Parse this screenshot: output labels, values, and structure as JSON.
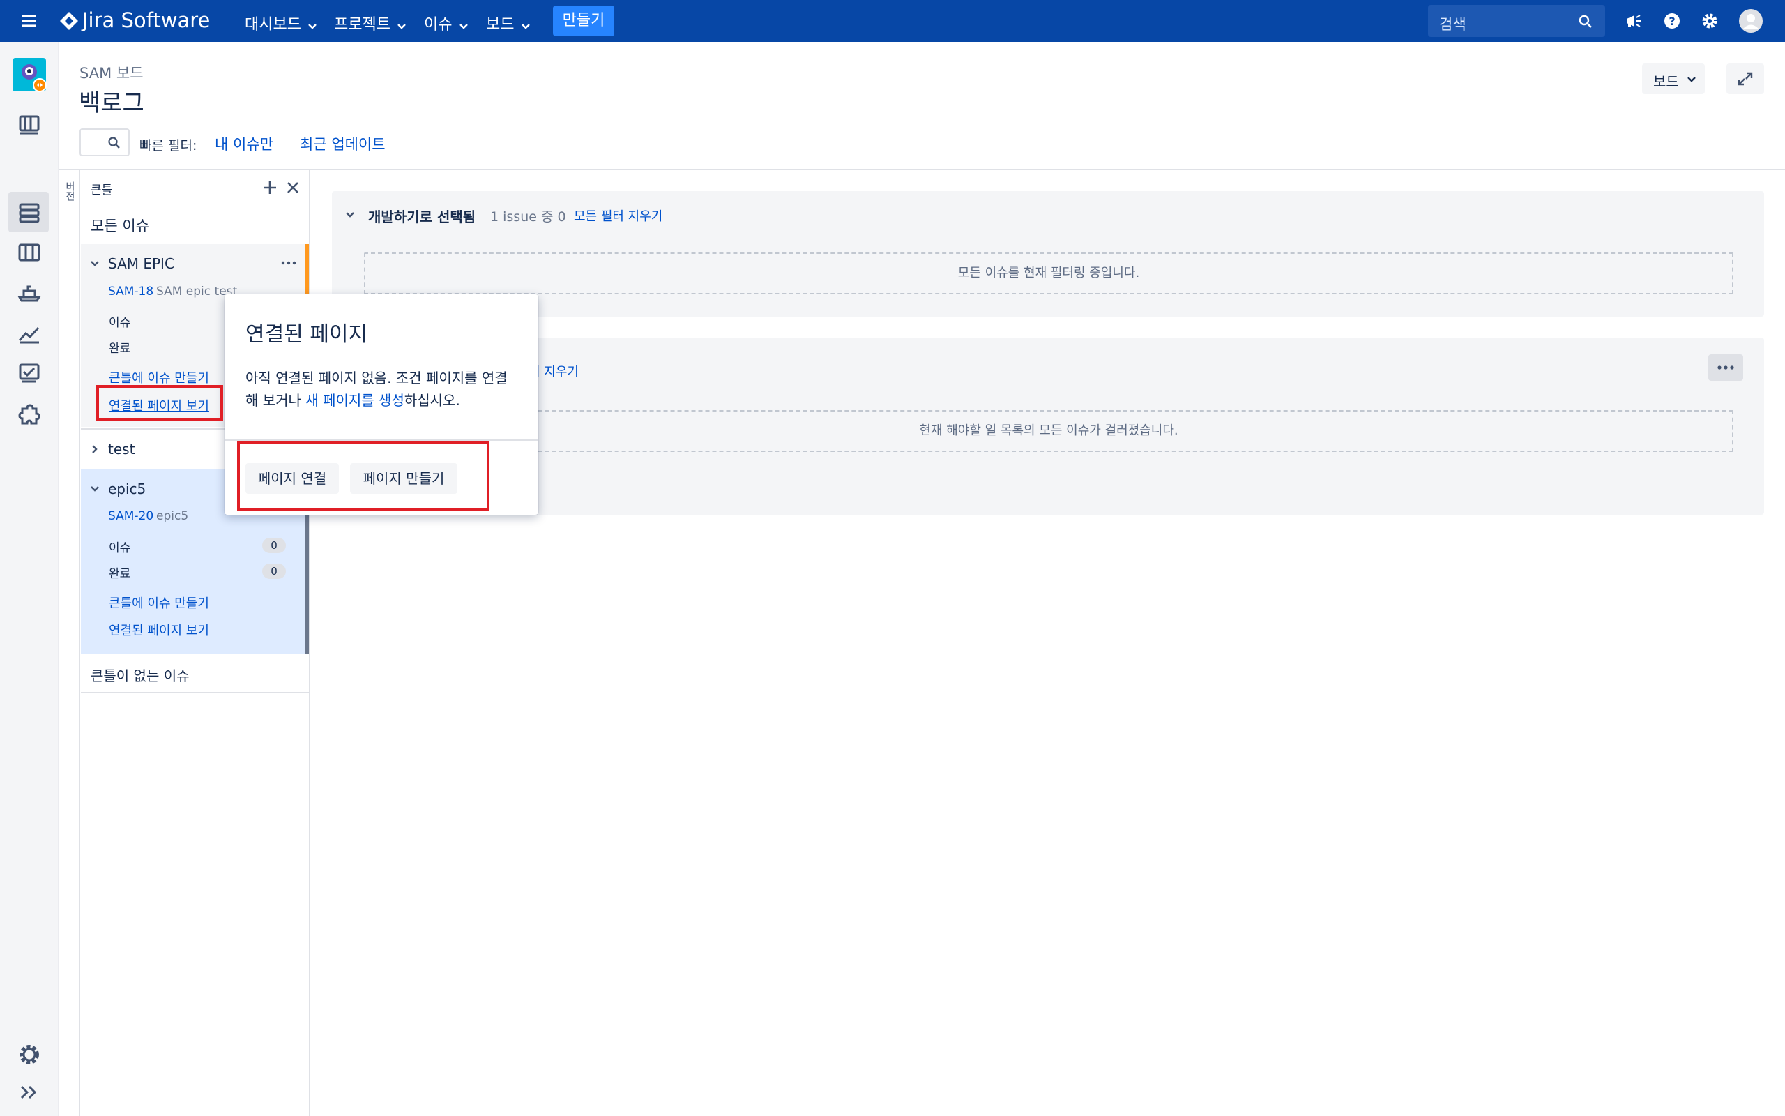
{
  "topnav": {
    "brand": "Jira Software",
    "menu": [
      {
        "label": "대시보드"
      },
      {
        "label": "프로젝트"
      },
      {
        "label": "이슈"
      },
      {
        "label": "보드"
      }
    ],
    "create_label": "만들기",
    "search_placeholder": "검색"
  },
  "header": {
    "breadcrumb": "SAM 보드",
    "title": "백로그",
    "board_button": "보드",
    "quick_filters_label": "빠른 필터:",
    "quick_filters": [
      "내 이슈만",
      "최근 업데이트"
    ]
  },
  "epic_panel": {
    "vertical_tab": "버전",
    "title": "큰틀",
    "all_issues": "모든 이슈",
    "epics": [
      {
        "name": "SAM EPIC",
        "key": "SAM-18",
        "summary": "SAM epic test",
        "issues_label": "이슈",
        "done_label": "완료",
        "create_link": "큰틀에 이슈 만들기",
        "pages_link": "연결된 페이지 보기"
      },
      {
        "name": "test"
      },
      {
        "name": "epic5",
        "key": "SAM-20",
        "summary": "epic5",
        "issues_label": "이슈",
        "issues_count": "0",
        "done_label": "완료",
        "done_count": "0",
        "create_link": "큰틀에 이슈 만들기",
        "pages_link": "연결된 페이지 보기"
      }
    ],
    "no_epic": "큰틀이 없는 이슈"
  },
  "sprint": {
    "title": "개발하기로 선택됨",
    "count_text": "1 issue 중 0",
    "clear_filters": "모든 필터 지우기",
    "empty_text": "모든 이슈를 현재 필터링 중입니다."
  },
  "backlog": {
    "clear_filters_partial": "터 지우기",
    "empty_text": "현재 해야할 일 목록의 모든 이슈가 걸러졌습니다."
  },
  "popover": {
    "title": "연결된 페이지",
    "body_line1": "아직 연결된 페이지 없음. 조건 페이지를 연결",
    "body_line2_prefix": "해 보거나 ",
    "body_link": "새 페이지를 생성",
    "body_line2_suffix": "하십시오.",
    "link_page_button": "페이지 연결",
    "create_page_button": "페이지 만들기"
  },
  "colors": {
    "nav_bg": "#0747a6",
    "create_btn": "#2684ff",
    "link": "#0052cc",
    "epic_orange": "#ff991f",
    "highlight_red": "#e01f26"
  },
  "icons": [
    "menu-icon",
    "jira-logo-icon",
    "search-icon",
    "megaphone-icon",
    "help-icon",
    "settings-icon",
    "avatar-icon",
    "project-avatar-icon",
    "roadmap-icon",
    "backlog-icon",
    "board-icon",
    "releases-icon",
    "reports-icon",
    "issues-icon",
    "addons-icon",
    "expand-sidebar-icon",
    "fullscreen-icon"
  ]
}
